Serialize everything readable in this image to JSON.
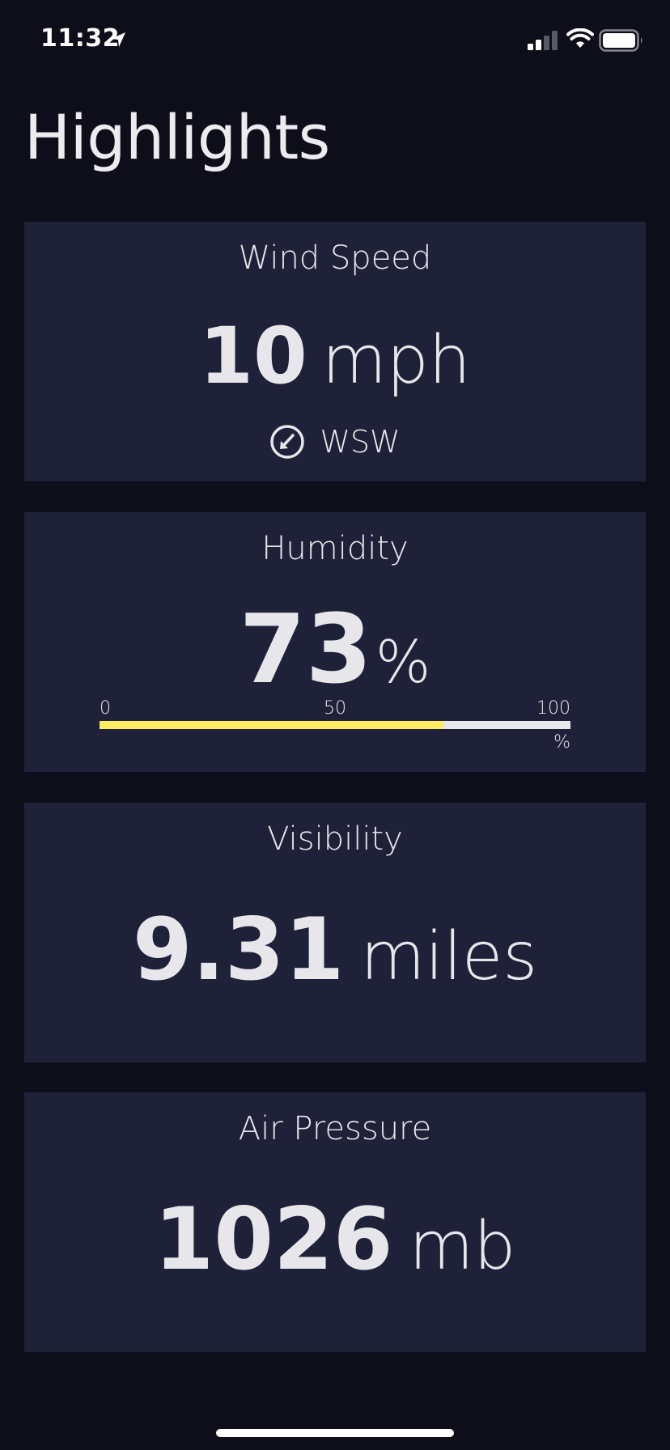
{
  "status_bar": {
    "time": "11:32",
    "icons": [
      "location-arrow-icon",
      "signal-icon",
      "wifi-icon",
      "battery-icon"
    ]
  },
  "title": "Highlights",
  "colors": {
    "background": "#0e0e1b",
    "card": "#1f2139",
    "text": "#e7e7eb",
    "humidity_fill": "#ffec65"
  },
  "cards": {
    "wind": {
      "title": "Wind Speed",
      "value": "10",
      "unit": "mph",
      "direction": "WSW",
      "direction_icon": "compass-arrow-icon"
    },
    "humidity": {
      "title": "Humidity",
      "value": "73",
      "unit": "%",
      "scale_min": "0",
      "scale_mid": "50",
      "scale_max": "100",
      "scale_unit": "%",
      "percent": 73
    },
    "visibility": {
      "title": "Visibility",
      "value": "9.31",
      "unit": "miles"
    },
    "pressure": {
      "title": "Air Pressure",
      "value": "1026",
      "unit": "mb"
    }
  }
}
